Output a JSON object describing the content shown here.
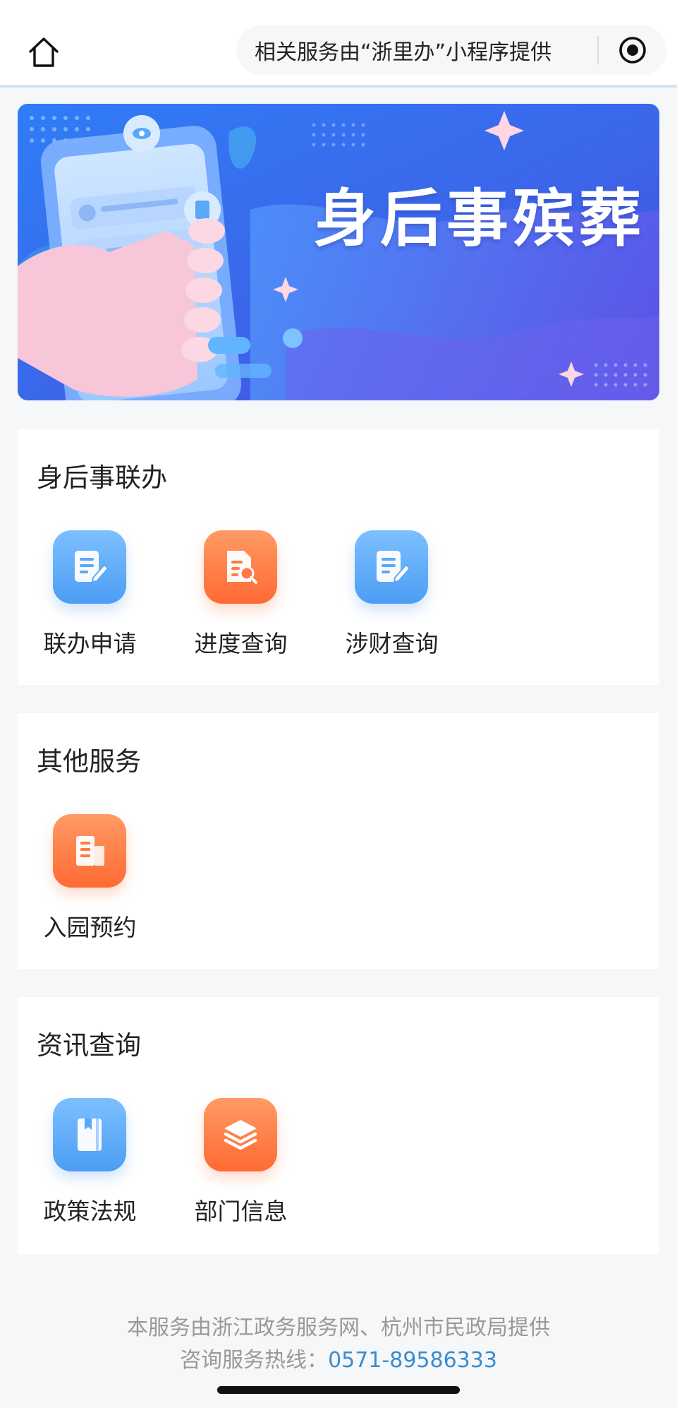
{
  "header": {
    "capsule_text": "相关服务由“浙里办”小程序提供"
  },
  "banner": {
    "title": "身后事殡葬"
  },
  "sections": [
    {
      "title": "身后事联办",
      "items": [
        {
          "label": "联办申请",
          "icon": "edit-document-icon",
          "color": "#5aa8f8"
        },
        {
          "label": "进度查询",
          "icon": "document-search-icon",
          "color": "#ff7a45"
        },
        {
          "label": "涉财查询",
          "icon": "edit-document-icon",
          "color": "#5aa8f8"
        }
      ]
    },
    {
      "title": "其他服务",
      "items": [
        {
          "label": "入园预约",
          "icon": "building-icon",
          "color": "#ff7a45"
        }
      ]
    },
    {
      "title": "资讯查询",
      "items": [
        {
          "label": "政策法规",
          "icon": "book-icon",
          "color": "#5aa8f8"
        },
        {
          "label": "部门信息",
          "icon": "layers-icon",
          "color": "#ff7a45"
        }
      ]
    }
  ],
  "footer": {
    "line1": "本服务由浙江政务服务网、杭州市民政局提供",
    "hotline_label": "咨询服务热线：",
    "hotline_number": "0571-89586333"
  }
}
